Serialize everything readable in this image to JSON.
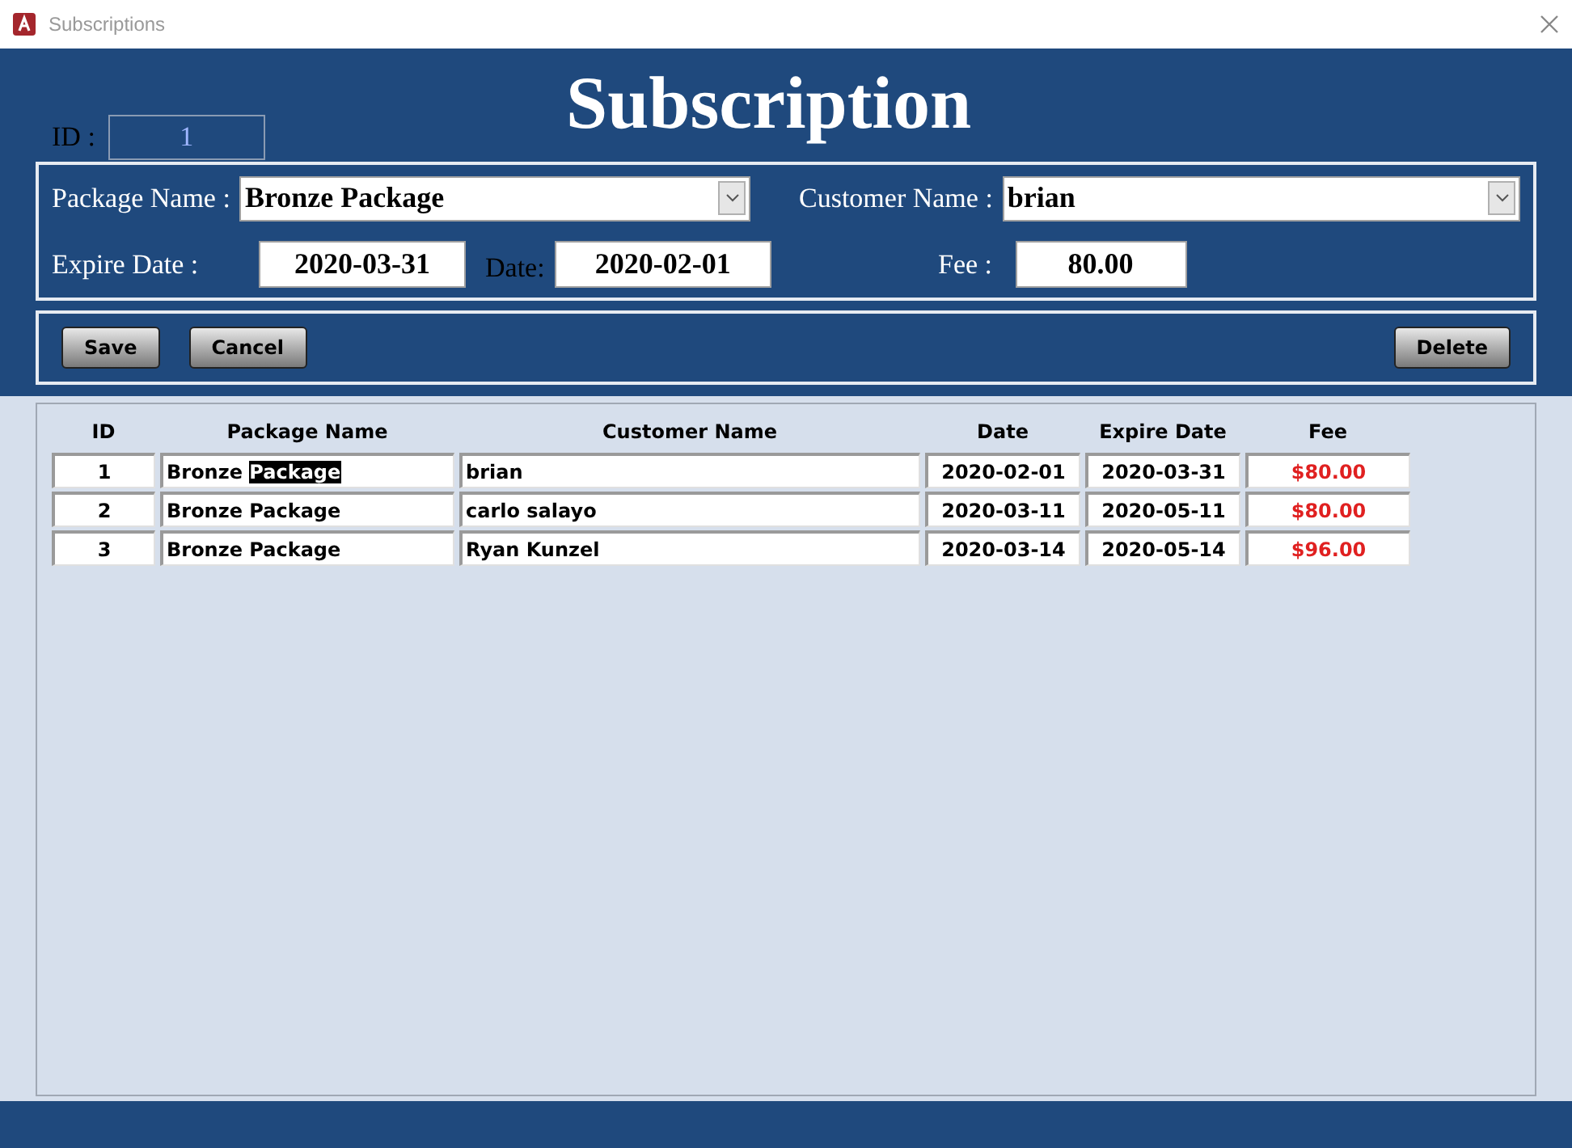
{
  "window": {
    "title": "Subscriptions"
  },
  "form": {
    "title": "Subscription",
    "id_label": "ID :",
    "id_value": "1",
    "fields": [
      {
        "label": "Package Name :",
        "value": "Bronze Package",
        "kind": "combo"
      },
      {
        "label": "Customer Name :",
        "value": "brian",
        "kind": "combo"
      },
      {
        "label": "Expire Date :",
        "value": "2020-03-31",
        "kind": "text"
      },
      {
        "label": "Date:",
        "value": "2020-02-01",
        "kind": "text"
      },
      {
        "label": "Fee :",
        "value": "80.00",
        "kind": "text"
      }
    ],
    "buttons": [
      "Save",
      "Cancel",
      "Delete"
    ]
  },
  "table": {
    "columns": [
      "ID",
      "Package Name",
      "Customer Name",
      "Date",
      "Expire Date",
      "Fee"
    ],
    "rows": [
      {
        "id": "1",
        "package": "Bronze ",
        "package_selected": "Package",
        "customer": "brian",
        "date": "2020-02-01",
        "expire": "2020-03-31",
        "fee": "$80.00"
      },
      {
        "id": "2",
        "package": "Bronze Package",
        "customer": "carlo salayo",
        "date": "2020-03-11",
        "expire": "2020-05-11",
        "fee": "$80.00"
      },
      {
        "id": "3",
        "package": "Bronze Package",
        "customer": "Ryan Kunzel",
        "date": "2020-03-14",
        "expire": "2020-05-14",
        "fee": "$96.00"
      }
    ]
  }
}
